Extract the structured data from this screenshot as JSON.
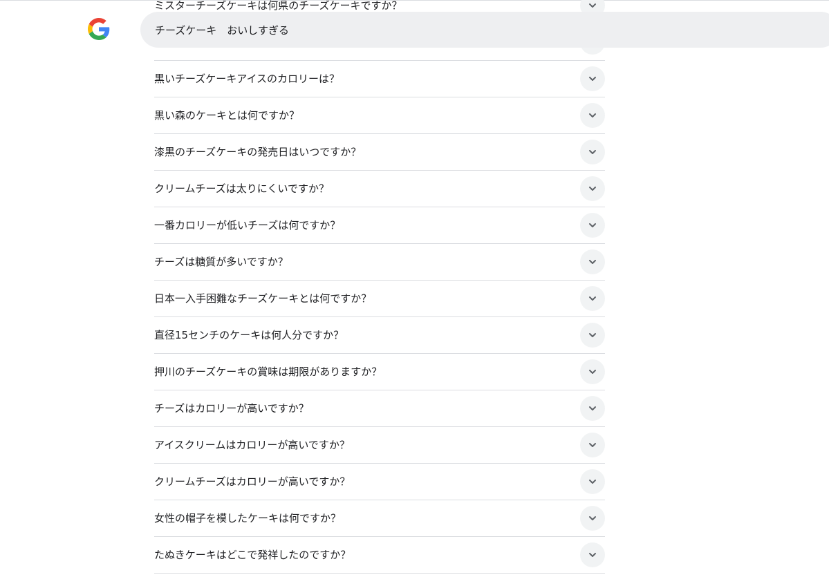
{
  "search": {
    "query": "チーズケーキ　おいしすぎる"
  },
  "icons": {
    "logo": "google-g-logo",
    "expand": "chevron-down-icon"
  },
  "colors": {
    "chip_bg": "#f1f3f4",
    "divider": "#dadce0",
    "search_bg": "#eeeff1"
  },
  "questions": [
    "ミスターチーズケーキは何県のチーズケーキですか？",
    "黒いチーズケーキアイスのカロリーは？",
    "黒い森のケーキとは何ですか？",
    "漆黒のチーズケーキの発売日はいつですか？",
    "クリームチーズは太りにくいですか？",
    "一番カロリーが低いチーズは何ですか？",
    "チーズは糖質が多いですか？",
    "日本一入手困難なチーズケーキとは何ですか？",
    "直径15センチのケーキは何人分ですか？",
    "押川のチーズケーキの賞味は期限がありますか？",
    "チーズはカロリーが高いですか？",
    "アイスクリームはカロリーが高いですか？",
    "クリームチーズはカロリーが高いですか？",
    "女性の帽子を模したケーキは何ですか？",
    "たぬきケーキはどこで発祥したのですか？"
  ]
}
